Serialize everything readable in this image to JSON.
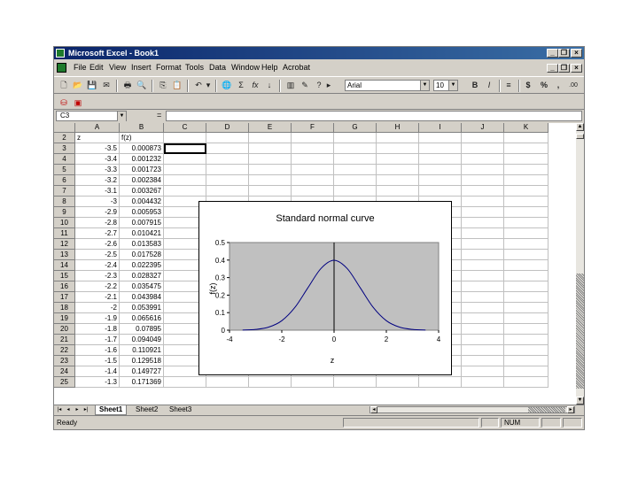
{
  "window": {
    "title": "Microsoft Excel - Book1"
  },
  "menu": [
    "File",
    "Edit",
    "View",
    "Insert",
    "Format",
    "Tools",
    "Data",
    "Window",
    "Help",
    "Acrobat"
  ],
  "toolbar": {
    "font_name": "Arial",
    "font_size": "10",
    "bold": "B",
    "italic": "I",
    "currency": "$",
    "percent": "%",
    "comma": ",",
    "inc_decimal": ".00"
  },
  "formula_bar": {
    "name_box": "C3",
    "equals": "="
  },
  "columns": [
    "A",
    "B",
    "C",
    "D",
    "E",
    "F",
    "G",
    "H",
    "I",
    "J",
    "K"
  ],
  "rows": [
    {
      "n": "2",
      "a": "z",
      "b": "f(z)"
    },
    {
      "n": "3",
      "a": "-3.5",
      "b": "0.000873"
    },
    {
      "n": "4",
      "a": "-3.4",
      "b": "0.001232"
    },
    {
      "n": "5",
      "a": "-3.3",
      "b": "0.001723"
    },
    {
      "n": "6",
      "a": "-3.2",
      "b": "0.002384"
    },
    {
      "n": "7",
      "a": "-3.1",
      "b": "0.003267"
    },
    {
      "n": "8",
      "a": "-3",
      "b": "0.004432"
    },
    {
      "n": "9",
      "a": "-2.9",
      "b": "0.005953"
    },
    {
      "n": "10",
      "a": "-2.8",
      "b": "0.007915"
    },
    {
      "n": "11",
      "a": "-2.7",
      "b": "0.010421"
    },
    {
      "n": "12",
      "a": "-2.6",
      "b": "0.013583"
    },
    {
      "n": "13",
      "a": "-2.5",
      "b": "0.017528"
    },
    {
      "n": "14",
      "a": "-2.4",
      "b": "0.022395"
    },
    {
      "n": "15",
      "a": "-2.3",
      "b": "0.028327"
    },
    {
      "n": "16",
      "a": "-2.2",
      "b": "0.035475"
    },
    {
      "n": "17",
      "a": "-2.1",
      "b": "0.043984"
    },
    {
      "n": "18",
      "a": "-2",
      "b": "0.053991"
    },
    {
      "n": "19",
      "a": "-1.9",
      "b": "0.065616"
    },
    {
      "n": "20",
      "a": "-1.8",
      "b": "0.07895"
    },
    {
      "n": "21",
      "a": "-1.7",
      "b": "0.094049"
    },
    {
      "n": "22",
      "a": "-1.6",
      "b": "0.110921"
    },
    {
      "n": "23",
      "a": "-1.5",
      "b": "0.129518"
    },
    {
      "n": "24",
      "a": "-1.4",
      "b": "0.149727"
    },
    {
      "n": "25",
      "a": "-1.3",
      "b": "0.171369"
    }
  ],
  "sheet_tabs": [
    "Sheet1",
    "Sheet2",
    "Sheet3"
  ],
  "status": {
    "ready": "Ready",
    "num": "NUM"
  },
  "chart_data": {
    "type": "line",
    "title": "Standard normal curve",
    "xlabel": "z",
    "ylabel": "f(z)",
    "xlim": [
      -4,
      4
    ],
    "ylim": [
      0,
      0.5
    ],
    "x_ticks": [
      "-4",
      "-2",
      "0",
      "2",
      "4"
    ],
    "y_ticks": [
      "0",
      "0.1",
      "0.2",
      "0.3",
      "0.4",
      "0.5"
    ],
    "plot_bg": "#c0c0c0",
    "line_color": "#000080",
    "series": [
      {
        "x": [
          -3.5,
          -3.0,
          -2.5,
          -2.0,
          -1.5,
          -1.0,
          -0.5,
          0,
          0.5,
          1.0,
          1.5,
          2.0,
          2.5,
          3.0,
          3.5
        ],
        "values": [
          0.0009,
          0.0044,
          0.0175,
          0.054,
          0.1295,
          0.242,
          0.3521,
          0.3989,
          0.3521,
          0.242,
          0.1295,
          0.054,
          0.0175,
          0.0044,
          0.0009
        ]
      }
    ]
  }
}
